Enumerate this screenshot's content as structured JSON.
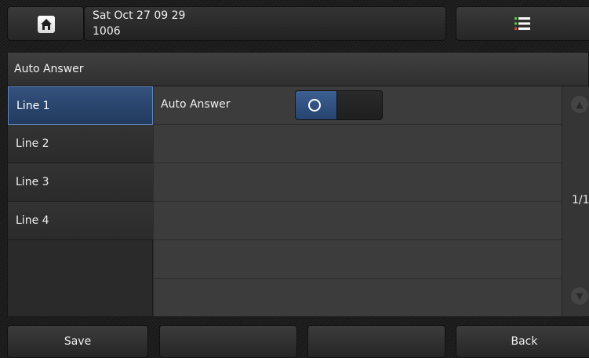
{
  "header": {
    "date_time": "Sat Oct 27 09 29",
    "extension": "1006"
  },
  "panel": {
    "title": "Auto Answer"
  },
  "sidebar": {
    "items": [
      {
        "label": "Line 1",
        "selected": true
      },
      {
        "label": "Line 2",
        "selected": false
      },
      {
        "label": "Line 3",
        "selected": false
      },
      {
        "label": "Line 4",
        "selected": false
      }
    ]
  },
  "settings": {
    "rows": [
      {
        "label": "Auto Answer",
        "toggle_state": "on"
      },
      {
        "label": ""
      },
      {
        "label": ""
      },
      {
        "label": ""
      },
      {
        "label": ""
      },
      {
        "label": ""
      }
    ]
  },
  "pagination": {
    "indicator": "1/1"
  },
  "softkeys": {
    "save_label": "Save",
    "key2_label": "",
    "key3_label": "",
    "back_label": "Back"
  },
  "colors": {
    "accent": "#2e4d7c",
    "background": "#1c1c1c",
    "row": "#3c3c3c"
  },
  "icons": [
    "home-icon",
    "menu-icon",
    "scroll-up-icon",
    "scroll-down-icon"
  ]
}
